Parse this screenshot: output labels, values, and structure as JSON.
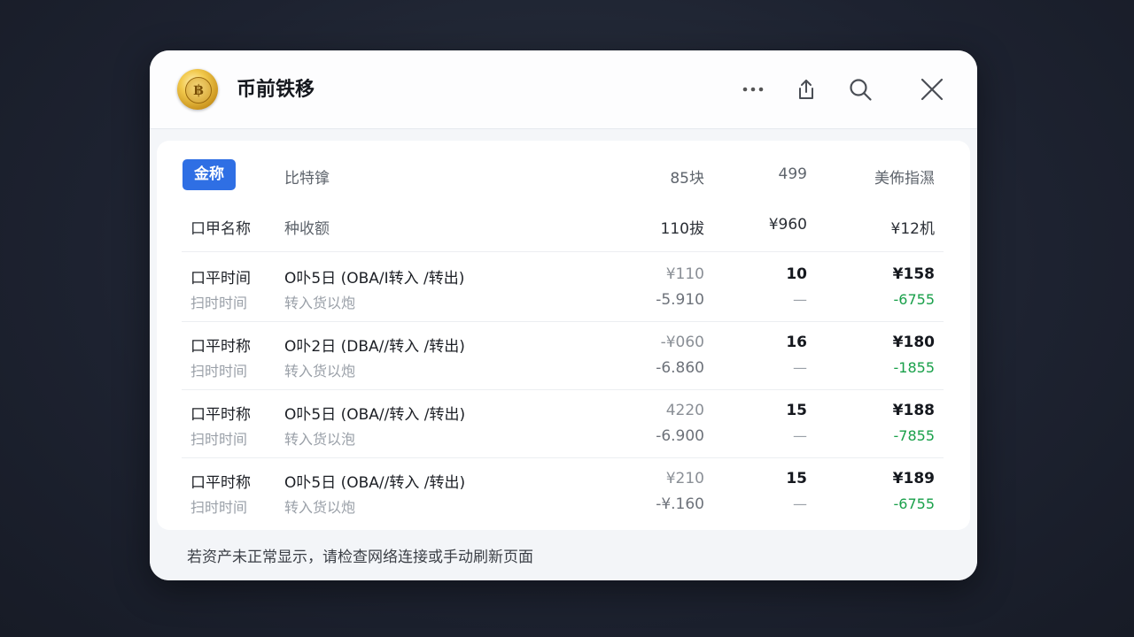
{
  "window": {
    "title": "币前铁移",
    "coin_glyph": "฿",
    "icons": [
      "more-icon",
      "share-icon",
      "search-icon",
      "close-icon"
    ]
  },
  "header": {
    "tag": "金称",
    "col2": "比特镎",
    "col3": "85块",
    "col4": "499",
    "col5": "美佈指濕"
  },
  "summary": {
    "col1": "口甲名称",
    "col2": "种收额",
    "col3": "110拔",
    "col4": "¥960",
    "col5": "¥12机"
  },
  "rows": [
    {
      "label": "口平时间",
      "sublabel": "扫时时间",
      "desc": "O卟5日 (OBA/I转入 /转出)",
      "subdesc": "转入货以炮",
      "amount": "¥110",
      "subamount": "-5.910",
      "count": "10",
      "subcount": "—",
      "total": "¥158",
      "subtotal": "-6755"
    },
    {
      "label": "口平时称",
      "sublabel": "扫时时间",
      "desc": "O卟2日 (DBA//转入 /转出)",
      "subdesc": "转入货以炮",
      "amount": "-¥060",
      "subamount": "-6.860",
      "count": "16",
      "subcount": "—",
      "total": "¥180",
      "subtotal": "-1855"
    },
    {
      "label": "口平时称",
      "sublabel": "扫时时间",
      "desc": "O卟5日 (OBA//转入 /转出)",
      "subdesc": "转入货以泡",
      "amount": "4220",
      "subamount": "-6.900",
      "count": "15",
      "subcount": "—",
      "total": "¥188",
      "subtotal": "-7855"
    },
    {
      "label": "口平时称",
      "sublabel": "扫时时间",
      "desc": "O卟5日 (OBA//转入 /转出)",
      "subdesc": "转入货以炮",
      "amount": "¥210",
      "subamount": "-¥.160",
      "count": "15",
      "subcount": "—",
      "total": "¥189",
      "subtotal": "-6755"
    }
  ],
  "footer": {
    "text": "若资产未正常显示，请检查网络连接或手动刷新页面"
  },
  "colors": {
    "accent": "#2f6fe4",
    "positive_delta": "#19a04a",
    "background": "#1d2230"
  }
}
